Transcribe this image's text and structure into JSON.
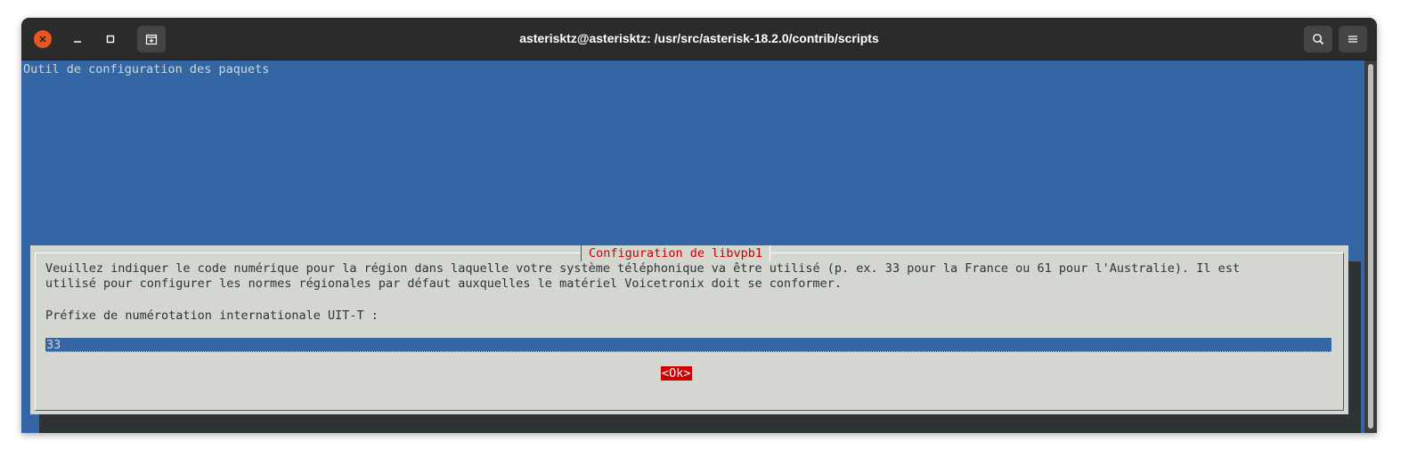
{
  "window": {
    "title": "asterisktz@asterisktz: /usr/src/asterisk-18.2.0/contrib/scripts"
  },
  "terminal": {
    "header": "Outil de configuration des paquets"
  },
  "dialog": {
    "title": "Configuration de libvpb1",
    "description": "Veuillez indiquer le code numérique pour la région dans laquelle votre système téléphonique va être utilisé (p. ex. 33 pour la France ou 61 pour l'Australie). Il est\nutilisé pour configurer les normes régionales par défaut auxquelles le matériel Voicetronix doit se conformer.",
    "prompt_label": "Préfixe de numérotation internationale UIT-T :",
    "input_value": "33",
    "ok_label": "<Ok>"
  },
  "colors": {
    "terminal_bg": "#3465a4",
    "dialog_bg": "#d3d7cf",
    "accent_red": "#cc0000",
    "close_button": "#e95420"
  },
  "icons": {
    "close": "close-icon",
    "minimize": "minimize-icon",
    "maximize": "maximize-icon",
    "new_tab": "new-tab-icon",
    "search": "search-icon",
    "menu": "hamburger-menu-icon"
  }
}
